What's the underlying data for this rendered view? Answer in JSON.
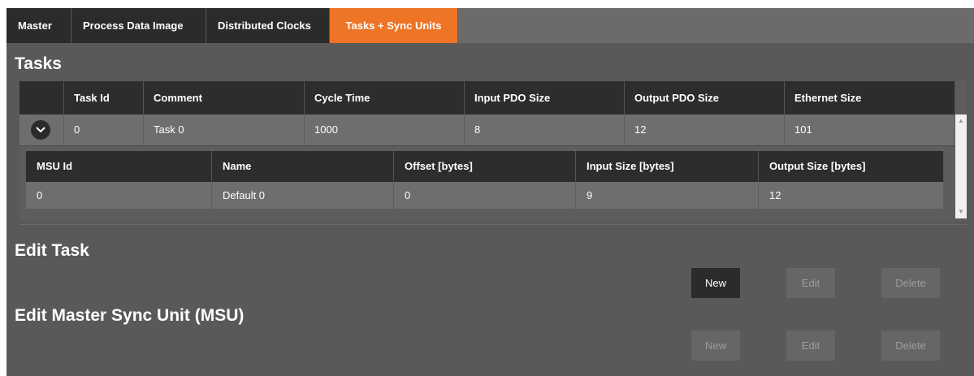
{
  "tabs": [
    {
      "label": "Master"
    },
    {
      "label": "Process Data Image"
    },
    {
      "label": "Distributed Clocks"
    },
    {
      "label": "Tasks + Sync Units",
      "active": true
    }
  ],
  "tasks_section": {
    "title": "Tasks",
    "columns": [
      "Task Id",
      "Comment",
      "Cycle Time",
      "Input PDO Size",
      "Output PDO Size",
      "Ethernet Size"
    ],
    "rows": [
      {
        "task_id": "0",
        "comment": "Task 0",
        "cycle_time": "1000",
        "input_pdo_size": "8",
        "output_pdo_size": "12",
        "ethernet_size": "101",
        "expanded": true
      }
    ],
    "msu_grid": {
      "columns": [
        "MSU Id",
        "Name",
        "Offset [bytes]",
        "Input Size [bytes]",
        "Output Size [bytes]"
      ],
      "rows": [
        {
          "msu_id": "0",
          "name": "Default 0",
          "offset": "0",
          "input_size": "9",
          "output_size": "12"
        }
      ]
    }
  },
  "edit_task": {
    "title": "Edit Task",
    "buttons": {
      "new": "New",
      "edit": "Edit",
      "delete": "Delete"
    }
  },
  "edit_msu": {
    "title": "Edit Master Sync Unit (MSU)",
    "buttons": {
      "new": "New",
      "edit": "Edit",
      "delete": "Delete"
    }
  },
  "icons": {
    "expand": "chevron-down-icon",
    "scroll_up": "scroll-up-arrow-icon",
    "scroll_down": "scroll-down-arrow-icon"
  },
  "colors": {
    "accent": "#ee7526",
    "panel": "#595959",
    "header": "#2d2d2d",
    "row": "#6e6e6e"
  }
}
